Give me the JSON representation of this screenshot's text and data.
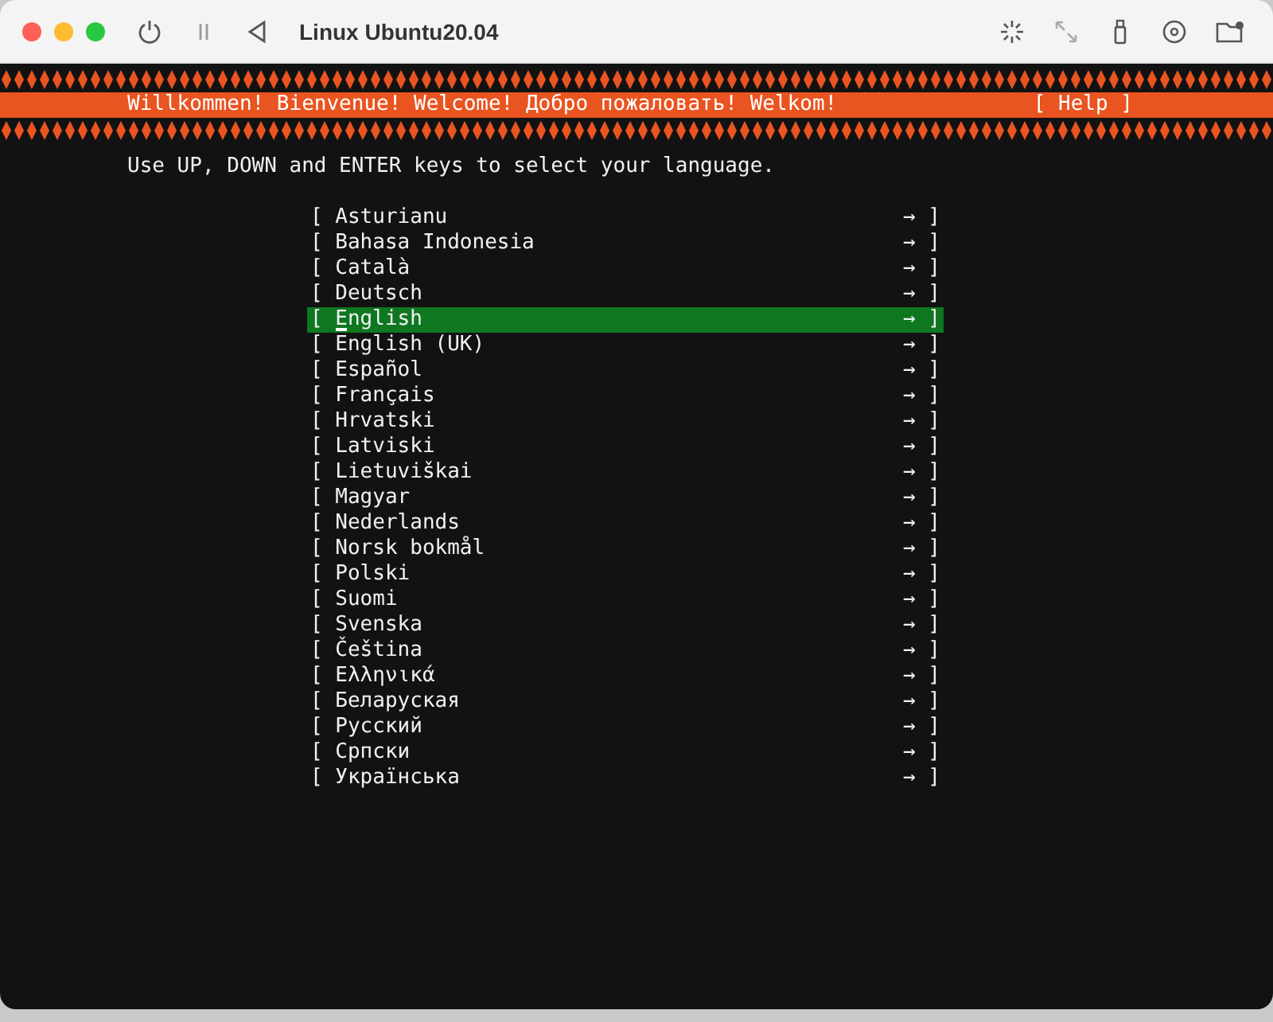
{
  "window": {
    "title": "Linux Ubuntu20.04"
  },
  "header": {
    "welcome": "Willkommen! Bienvenue! Welcome! Добро пожаловать! Welkom!",
    "help": "[ Help ]"
  },
  "instruction": "Use UP, DOWN and ENTER keys to select your language.",
  "languages": [
    {
      "text": "[ Asturianu",
      "end": "→ ]",
      "selected": false
    },
    {
      "text": "[ Bahasa Indonesia",
      "end": "→ ]",
      "selected": false
    },
    {
      "text": "[ Català",
      "end": "→ ]",
      "selected": false
    },
    {
      "text": "[ Deutsch",
      "end": "→ ]",
      "selected": false
    },
    {
      "text": "[ English",
      "end": "→ ]",
      "selected": true
    },
    {
      "text": "[ English (UK)",
      "end": "→ ]",
      "selected": false
    },
    {
      "text": "[ Español",
      "end": "→ ]",
      "selected": false
    },
    {
      "text": "[ Français",
      "end": "→ ]",
      "selected": false
    },
    {
      "text": "[ Hrvatski",
      "end": "→ ]",
      "selected": false
    },
    {
      "text": "[ Latviski",
      "end": "→ ]",
      "selected": false
    },
    {
      "text": "[ Lietuviškai",
      "end": "→ ]",
      "selected": false
    },
    {
      "text": "[ Magyar",
      "end": "→ ]",
      "selected": false
    },
    {
      "text": "[ Nederlands",
      "end": "→ ]",
      "selected": false
    },
    {
      "text": "[ Norsk bokmål",
      "end": "→ ]",
      "selected": false
    },
    {
      "text": "[ Polski",
      "end": "→ ]",
      "selected": false
    },
    {
      "text": "[ Suomi",
      "end": "→ ]",
      "selected": false
    },
    {
      "text": "[ Svenska",
      "end": "→ ]",
      "selected": false
    },
    {
      "text": "[ Čeština",
      "end": "→ ]",
      "selected": false
    },
    {
      "text": "[ Ελληνικά",
      "end": "→ ]",
      "selected": false
    },
    {
      "text": "[ Беларуская",
      "end": "→ ]",
      "selected": false
    },
    {
      "text": "[ Русский",
      "end": "→ ]",
      "selected": false
    },
    {
      "text": "[ Српски",
      "end": "→ ]",
      "selected": false
    },
    {
      "text": "[ Українська",
      "end": "→ ]",
      "selected": false
    }
  ]
}
